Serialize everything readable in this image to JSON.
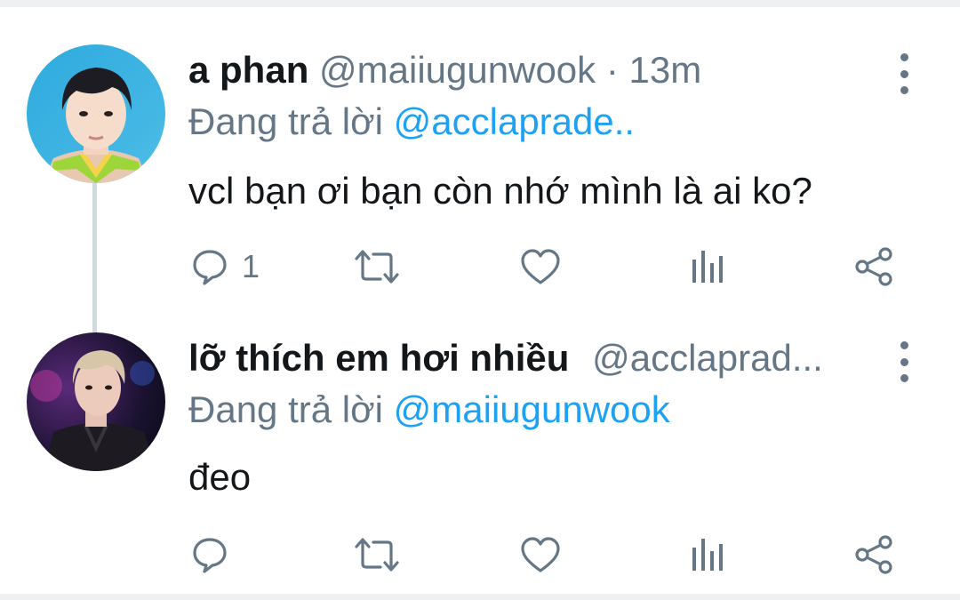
{
  "tweets": [
    {
      "display_name": "a phan",
      "handle": "@maiiugunwook",
      "separator": "·",
      "time": "13m",
      "reply_prefix": "Đang trả lời",
      "reply_to": "@acclaprade..",
      "text": "vcl bạn ơi bạn còn nhớ mình là ai ko?",
      "reply_count": "1",
      "avatar": "avatar-boy-green-shirt"
    },
    {
      "display_name": "lỡ thích em hơi nhiều",
      "handle": "@acclaprad...",
      "reply_prefix": "Đang trả lời",
      "reply_to": "@maiiugunwook",
      "text": "đeo",
      "avatar": "avatar-performer-stage"
    }
  ],
  "icons": {
    "reply": "reply-icon",
    "retweet": "retweet-icon",
    "like": "like-icon",
    "analytics": "analytics-icon",
    "share": "share-icon",
    "more": "more-icon"
  },
  "colors": {
    "text": "#14171a",
    "secondary": "#657786",
    "link": "#1da1f2",
    "thread_line": "#cfd9de"
  }
}
